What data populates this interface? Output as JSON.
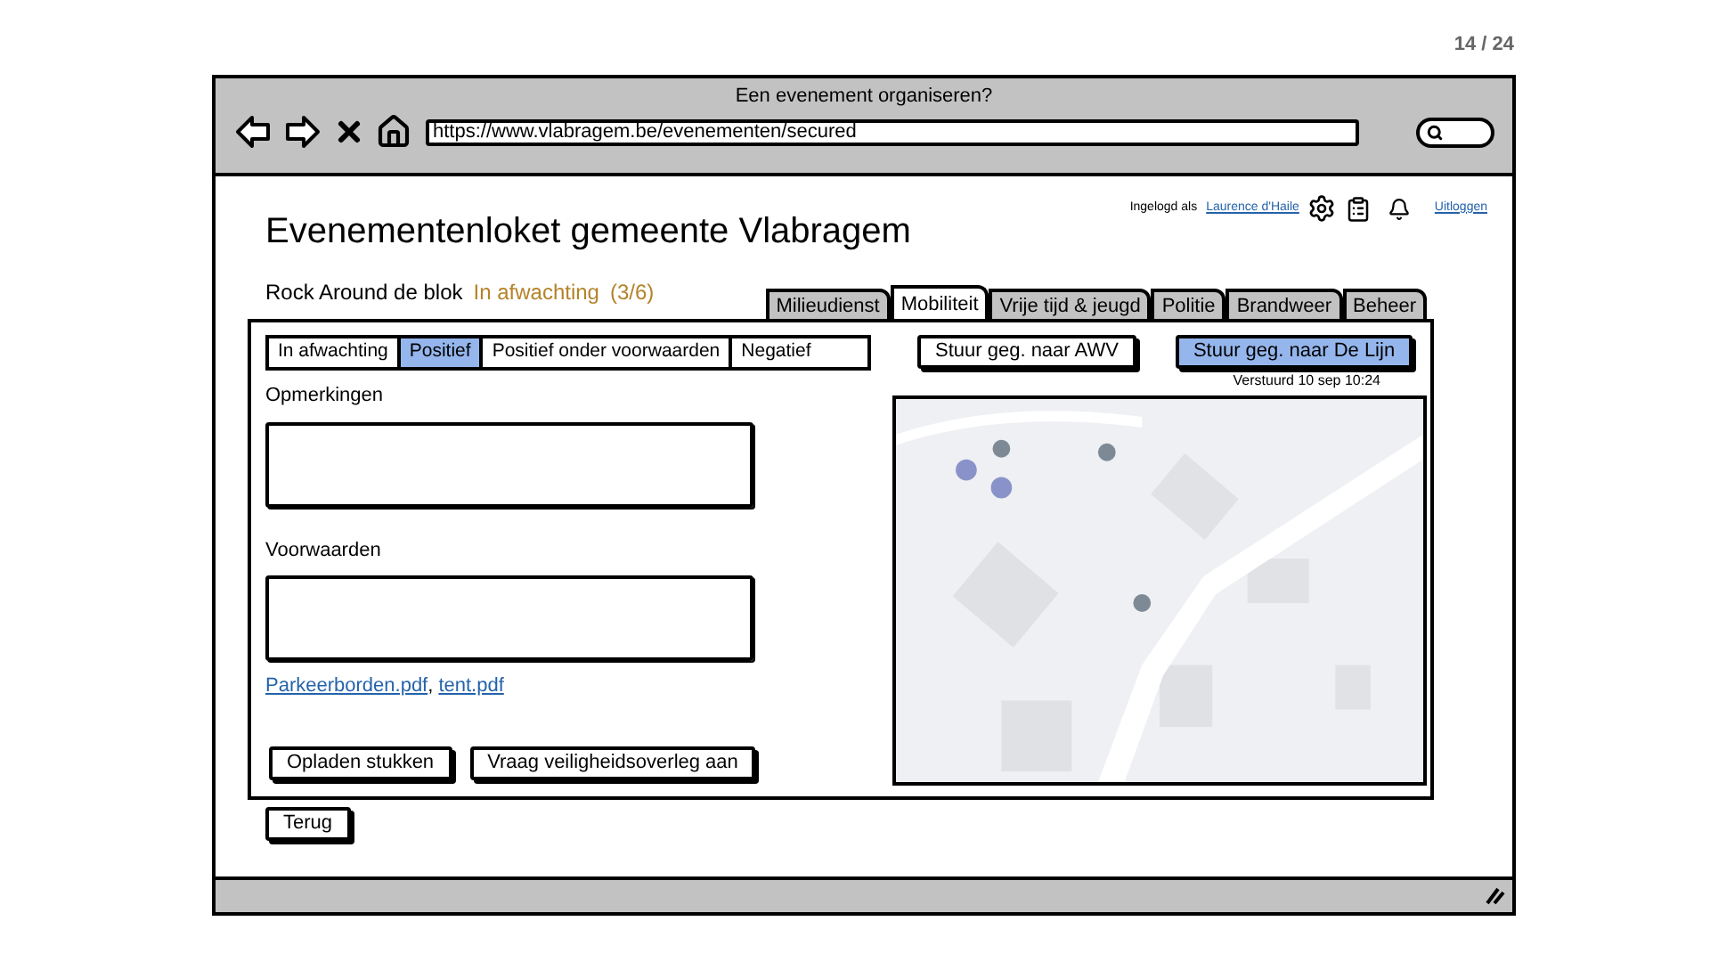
{
  "slide_counter": "14 / 24",
  "window": {
    "title": "Een evenement organiseren?",
    "url": "https://www.vlabragem.be/evenementen/secured"
  },
  "header": {
    "title": "Evenementenloket gemeente Vlabragem",
    "logged_in_label": "Ingelogd als",
    "user": "Laurence d'Haile",
    "logout": "Uitloggen"
  },
  "event": {
    "name": "Rock Around de blok",
    "status": "In afwachting",
    "progress": "(3/6)",
    "color": "#b5832a"
  },
  "tabs": [
    {
      "label": "Milieudienst",
      "selected": false
    },
    {
      "label": "Mobiliteit",
      "selected": true
    },
    {
      "label": "Vrije tijd & jeugd",
      "selected": false
    },
    {
      "label": "Politie",
      "selected": false
    },
    {
      "label": "Brandweer",
      "selected": false
    },
    {
      "label": "Beheer",
      "selected": false
    }
  ],
  "decision": [
    {
      "label": "In afwachting",
      "selected": false
    },
    {
      "label": "Positief",
      "selected": true
    },
    {
      "label": "Positief onder voorwaarden",
      "selected": false
    },
    {
      "label": "Negatief",
      "selected": false
    }
  ],
  "actions": [
    {
      "label": "Stuur geg. naar AWV",
      "selected": false
    },
    {
      "label": "Stuur geg. naar De Lijn",
      "selected": true
    }
  ],
  "sent": "Verstuurd 10 sep 10:24",
  "fields": [
    {
      "label": "Opmerkingen"
    },
    {
      "label": "Voorwaarden"
    }
  ],
  "attachments": [
    {
      "label": "Parkeerborden.pdf",
      "suffix": ","
    },
    {
      "label": "tent.pdf"
    }
  ],
  "buttons": [
    "Opladen stukken",
    "Vraag veiligheidsoverleg aan"
  ],
  "back": "Terug"
}
